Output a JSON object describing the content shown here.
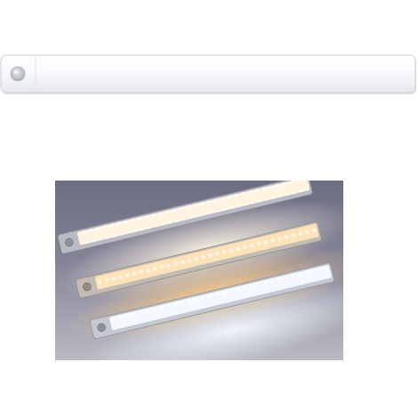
{
  "image": {
    "kind": "product-photo",
    "subject": "led-light-bar",
    "panels": [
      {
        "name": "single-bar-top-view",
        "bar_color": "#f2f4f8",
        "sensor_color": "#c9ccd4"
      },
      {
        "name": "three-bars-lit",
        "glow_colors": [
          "#fff2da",
          "#ffd59a",
          "#e8f2ff"
        ],
        "housing_color": "#b8bcc4"
      }
    ]
  }
}
